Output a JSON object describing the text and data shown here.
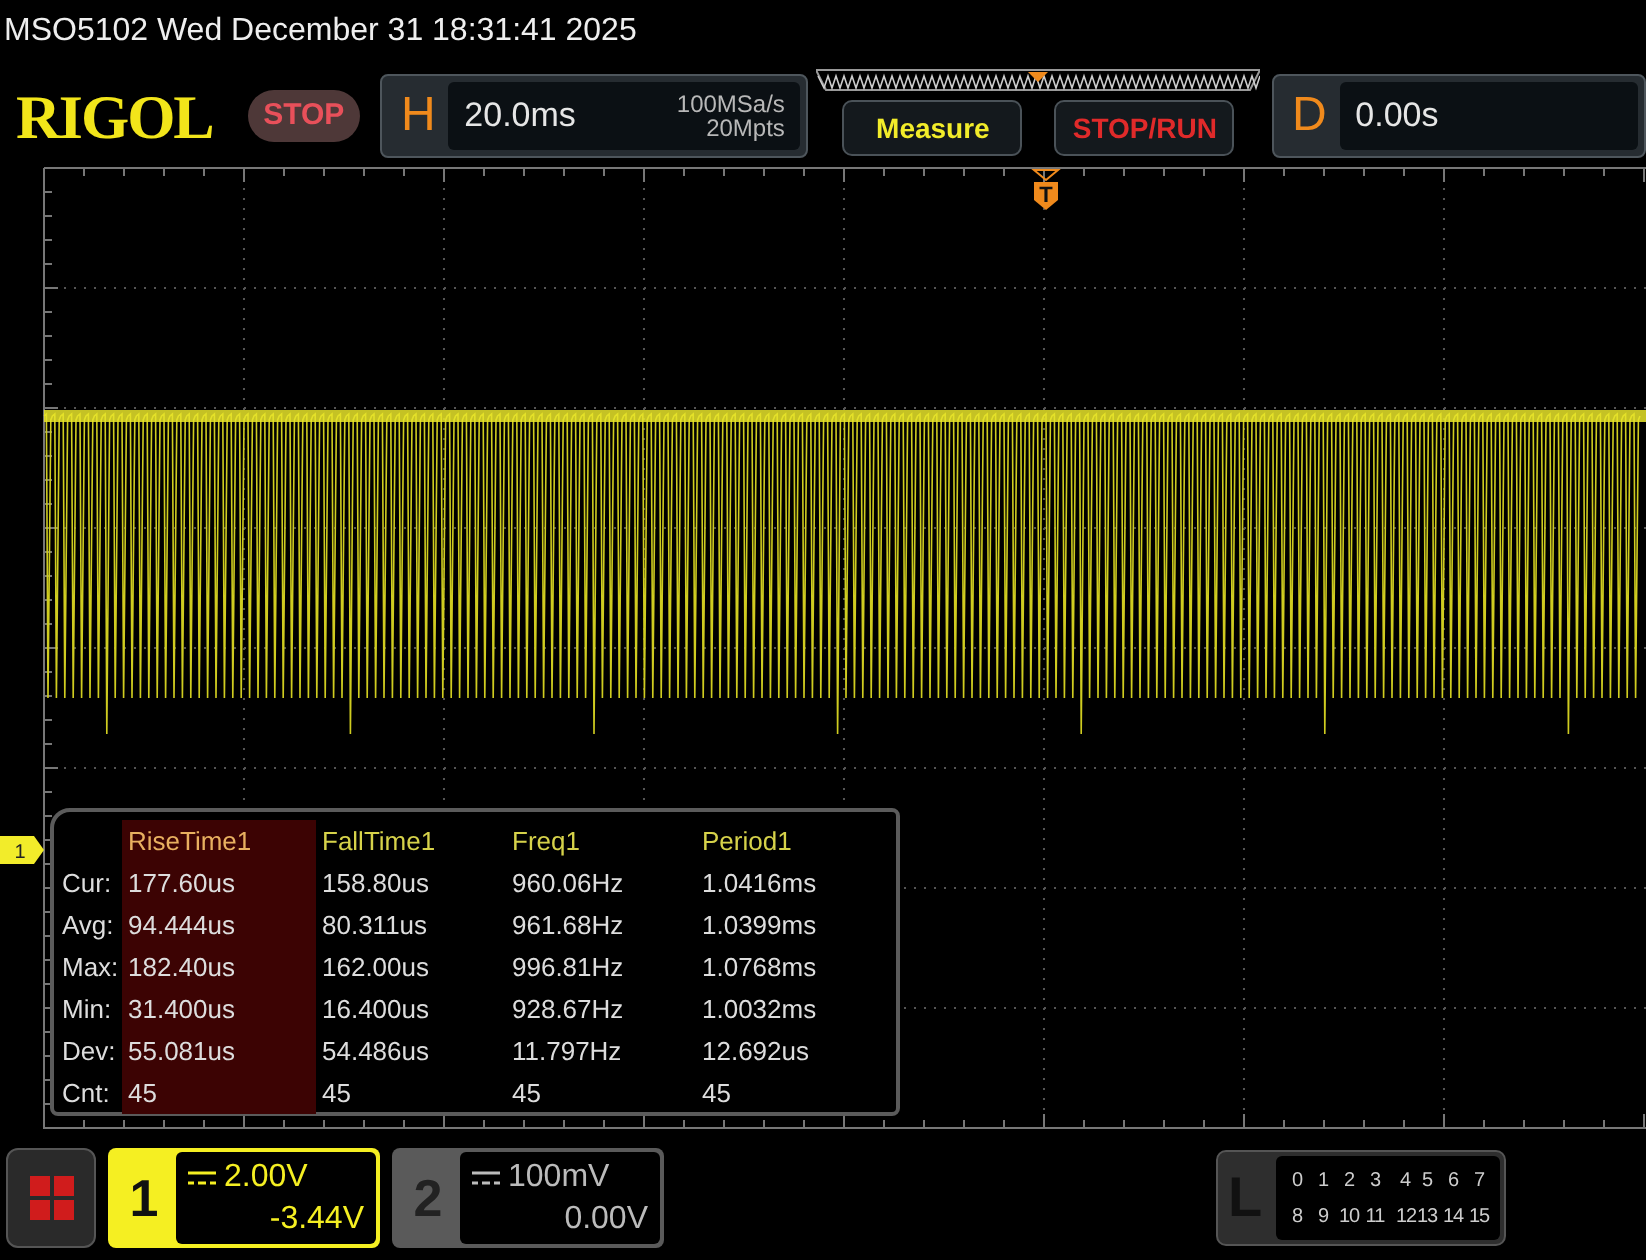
{
  "status_bar": {
    "text": "MSO5102  Wed December 31 18:31:41 2025"
  },
  "header": {
    "logo": "RIGOL",
    "run_state": "STOP",
    "timebase": {
      "label": "H",
      "scale": "20.0ms",
      "sample_rate": "100MSa/s",
      "memory_depth": "20Mpts"
    },
    "buttons": [
      {
        "label": "Measure",
        "kind": "measure"
      },
      {
        "label": "STOP/RUN",
        "kind": "run"
      }
    ],
    "delay": {
      "label": "D",
      "value": "0.00s"
    }
  },
  "screen": {
    "trigger_marker": "T",
    "channel_marker": "1"
  },
  "measurements": {
    "columns": [
      {
        "label": "RiseTime1",
        "selected": true
      },
      {
        "label": "FallTime1",
        "selected": false
      },
      {
        "label": "Freq1",
        "selected": false
      },
      {
        "label": "Period1",
        "selected": false
      }
    ],
    "rows": [
      {
        "label": "Cur:",
        "values": [
          "177.60us",
          "158.80us",
          "960.06Hz",
          "1.0416ms"
        ]
      },
      {
        "label": "Avg:",
        "values": [
          "94.444us",
          "80.311us",
          "961.68Hz",
          "1.0399ms"
        ]
      },
      {
        "label": "Max:",
        "values": [
          "182.40us",
          "162.00us",
          "996.81Hz",
          "1.0768ms"
        ]
      },
      {
        "label": "Min:",
        "values": [
          "31.400us",
          "16.400us",
          "928.67Hz",
          "1.0032ms"
        ]
      },
      {
        "label": "Dev:",
        "values": [
          "55.081us",
          "54.486us",
          "11.797Hz",
          "12.692us"
        ]
      },
      {
        "label": "Cnt:",
        "values": [
          "45",
          "45",
          "45",
          "45"
        ]
      }
    ]
  },
  "channels": [
    {
      "number": "1",
      "scale": "2.00V",
      "offset": "-3.44V",
      "on": true
    },
    {
      "number": "2",
      "scale": "100mV",
      "offset": "0.00V",
      "on": false
    }
  ],
  "logic": {
    "label": "L",
    "rows": [
      [
        "0",
        "1",
        "2",
        "3",
        "4",
        "5",
        "6",
        "7"
      ],
      [
        "8",
        "9",
        "10",
        "11",
        "12",
        "13",
        "14",
        "15"
      ]
    ]
  }
}
